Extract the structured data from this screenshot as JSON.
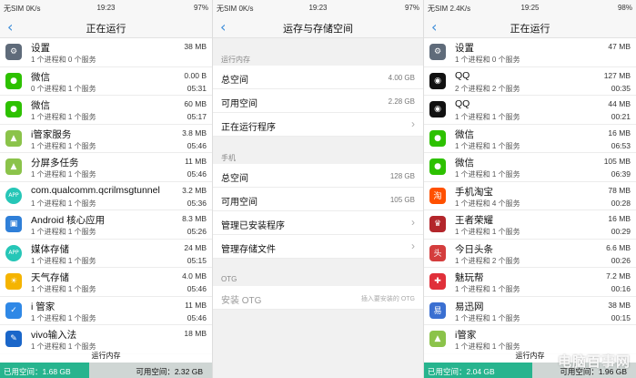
{
  "left": {
    "status": {
      "carrier": "无SIM 0K/s",
      "time": "19:23",
      "battery": "97%"
    },
    "title": "正在运行",
    "items": [
      {
        "name": "设置",
        "sub": "1 个进程和 0 个服务",
        "size": "38 MB",
        "time": "",
        "icon": "gear-icon",
        "color": "#5f6b7a",
        "glyph": "⚙"
      },
      {
        "name": "微信",
        "sub": "0 个进程和 1 个服务",
        "size": "0.00 B",
        "time": "05:31",
        "icon": "wechat-icon",
        "color": "#2dc100",
        "glyph": "●"
      },
      {
        "name": "微信",
        "sub": "1 个进程和 1 个服务",
        "size": "60 MB",
        "time": "05:17",
        "icon": "wechat-icon",
        "color": "#2dc100",
        "glyph": "●"
      },
      {
        "name": "i管家服务",
        "sub": "1 个进程和 1 个服务",
        "size": "3.8 MB",
        "time": "05:46",
        "icon": "android-icon",
        "color": "#8bc34a",
        "glyph": "▲"
      },
      {
        "name": "分屏多任务",
        "sub": "1 个进程和 1 个服务",
        "size": "11 MB",
        "time": "05:46",
        "icon": "android-icon",
        "color": "#8bc34a",
        "glyph": "▲"
      },
      {
        "name": "com.qualcomm.qcrilmsgtunnel",
        "sub": "1 个进程和 1 个服务",
        "size": "3.2 MB",
        "time": "05:36",
        "icon": "app-icon",
        "color": "#26c6b7",
        "glyph": "APP"
      },
      {
        "name": "Android 核心应用",
        "sub": "1 个进程和 1 个服务",
        "size": "8.3 MB",
        "time": "05:26",
        "icon": "contacts-icon",
        "color": "#2f7fd8",
        "glyph": "▣"
      },
      {
        "name": "媒体存储",
        "sub": "1 个进程和 1 个服务",
        "size": "24 MB",
        "time": "05:15",
        "icon": "app-icon",
        "color": "#26c6b7",
        "glyph": "APP"
      },
      {
        "name": "天气存储",
        "sub": "1 个进程和 1 个服务",
        "size": "4.0 MB",
        "time": "05:46",
        "icon": "weather-icon",
        "color": "#f5b400",
        "glyph": "☀"
      },
      {
        "name": "i 管家",
        "sub": "1 个进程和 1 个服务",
        "size": "11 MB",
        "time": "05:46",
        "icon": "shield-icon",
        "color": "#2f88e6",
        "glyph": "✓"
      },
      {
        "name": "vivo输入法",
        "sub": "1 个进程和 1 个服务",
        "size": "18 MB",
        "time": "",
        "icon": "keyboard-icon",
        "color": "#1a66c9",
        "glyph": "✎"
      }
    ],
    "bottom": {
      "label": "运行内存",
      "used": "已用空间：1.68 GB",
      "free": "可用空间：2.32 GB",
      "used_fraction": 0.42,
      "used_color": "#27b48e"
    }
  },
  "middle": {
    "status": {
      "carrier": "无SIM 0K/s",
      "time": "19:23",
      "battery": "97%"
    },
    "title": "运存与存储空间",
    "ram_section": "运行内存",
    "ram_rows": [
      {
        "label": "总空间",
        "value": "4.00 GB"
      },
      {
        "label": "可用空间",
        "value": "2.28 GB"
      },
      {
        "label": "正在运行程序",
        "value": "›"
      }
    ],
    "phone_section": "手机",
    "phone_rows": [
      {
        "label": "总空间",
        "value": "128 GB"
      },
      {
        "label": "可用空间",
        "value": "105 GB"
      },
      {
        "label": "管理已安装程序",
        "value": "›"
      },
      {
        "label": "管理存储文件",
        "value": "›"
      }
    ],
    "otg_section": "OTG",
    "otg_row": {
      "label": "安装 OTG",
      "value": "插入要安装的 OTG"
    }
  },
  "right": {
    "status": {
      "carrier": "无SIM 2.4K/s",
      "time": "19:25",
      "battery": "98%"
    },
    "title": "正在运行",
    "items": [
      {
        "name": "设置",
        "sub": "1 个进程和 0 个服务",
        "size": "47 MB",
        "time": "",
        "icon": "gear-icon",
        "color": "#5f6b7a",
        "glyph": "⚙"
      },
      {
        "name": "QQ",
        "sub": "2 个进程和 2 个服务",
        "size": "127 MB",
        "time": "00:35",
        "icon": "qq-icon",
        "color": "#111111",
        "glyph": "◉"
      },
      {
        "name": "QQ",
        "sub": "1 个进程和 1 个服务",
        "size": "44 MB",
        "time": "00:21",
        "icon": "qq-icon",
        "color": "#111111",
        "glyph": "◉"
      },
      {
        "name": "微信",
        "sub": "1 个进程和 1 个服务",
        "size": "16 MB",
        "time": "06:53",
        "icon": "wechat-icon",
        "color": "#2dc100",
        "glyph": "●"
      },
      {
        "name": "微信",
        "sub": "1 个进程和 1 个服务",
        "size": "105 MB",
        "time": "06:39",
        "icon": "wechat-icon",
        "color": "#2dc100",
        "glyph": "●"
      },
      {
        "name": "手机淘宝",
        "sub": "1 个进程和 4 个服务",
        "size": "78 MB",
        "time": "00:28",
        "icon": "taobao-icon",
        "color": "#ff5000",
        "glyph": "淘"
      },
      {
        "name": "王者荣耀",
        "sub": "1 个进程和 1 个服务",
        "size": "16 MB",
        "time": "00:29",
        "icon": "game-icon",
        "color": "#b3262b",
        "glyph": "♛"
      },
      {
        "name": "今日头条",
        "sub": "1 个进程和 2 个服务",
        "size": "6.6 MB",
        "time": "00:26",
        "icon": "news-icon",
        "color": "#d43d3d",
        "glyph": "头"
      },
      {
        "name": "魅玩帮",
        "sub": "1 个进程和 1 个服务",
        "size": "7.2 MB",
        "time": "00:16",
        "icon": "meiwan-icon",
        "color": "#e0303a",
        "glyph": "✚"
      },
      {
        "name": "易迅网",
        "sub": "1 个进程和 1 个服务",
        "size": "38 MB",
        "time": "00:15",
        "icon": "yixun-icon",
        "color": "#3a6fd1",
        "glyph": "易"
      },
      {
        "name": "i管家",
        "sub": "1 个进程和 1 个服务",
        "size": "",
        "time": "",
        "icon": "android-icon",
        "color": "#8bc34a",
        "glyph": "▲"
      }
    ],
    "bottom": {
      "label": "运行内存",
      "used": "已用空间：2.04 GB",
      "free": "可用空间：1.96 GB",
      "used_fraction": 0.51,
      "used_color": "#27b48e"
    },
    "watermark": "电脑百事网"
  }
}
